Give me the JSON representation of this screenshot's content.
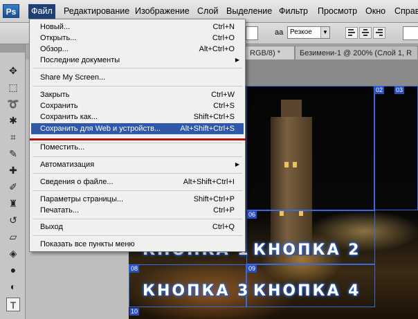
{
  "menubar": {
    "logo": "Ps",
    "items": [
      "Файл",
      "Редактирование",
      "Изображение",
      "Слой",
      "Выделение",
      "Фильтр",
      "Просмотр",
      "Окно",
      "Справ"
    ]
  },
  "options": {
    "aa_label": "aa",
    "antialias": "Резкое"
  },
  "tabs": [
    "RGB/8) *",
    "Безимени-1 @ 200% (Слой 1, R"
  ],
  "menu": {
    "items": [
      {
        "label": "Новый...",
        "shortcut": "Ctrl+N"
      },
      {
        "label": "Открыть...",
        "shortcut": "Ctrl+O"
      },
      {
        "label": "Обзор...",
        "shortcut": "Alt+Ctrl+O"
      },
      {
        "label": "Последние документы",
        "shortcut": "",
        "submenu": true
      },
      {
        "label": "Share My Screen...",
        "shortcut": ""
      },
      {
        "label": "Закрыть",
        "shortcut": "Ctrl+W"
      },
      {
        "label": "Сохранить",
        "shortcut": "Ctrl+S"
      },
      {
        "label": "Сохранить как...",
        "shortcut": "Shift+Ctrl+S"
      },
      {
        "label": "Сохранить для Web и устройств...",
        "shortcut": "Alt+Shift+Ctrl+S",
        "highlighted": true
      },
      {
        "label": "Поместить...",
        "shortcut": ""
      },
      {
        "label": "Автоматизация",
        "shortcut": "",
        "submenu": true
      },
      {
        "label": "Сведения о файле...",
        "shortcut": "Alt+Shift+Ctrl+I"
      },
      {
        "label": "Параметры страницы...",
        "shortcut": "Shift+Ctrl+P"
      },
      {
        "label": "Печатать...",
        "shortcut": "Ctrl+P"
      },
      {
        "label": "Выход",
        "shortcut": "Ctrl+Q"
      },
      {
        "label": "Показать все пункты меню",
        "shortcut": ""
      }
    ]
  },
  "canvas": {
    "slices": [
      "02",
      "03",
      "06",
      "08",
      "09",
      "10"
    ],
    "buttons": [
      "КНОПКА 1",
      "КНОПКА 2",
      "КНОПКА 3",
      "КНОПКА 4"
    ]
  },
  "colors": {
    "menu_highlight": "#2f58a8",
    "active_menu": "#1f3f74",
    "slice_blue": "#2a4fc0",
    "annotation_red": "#b01212"
  }
}
